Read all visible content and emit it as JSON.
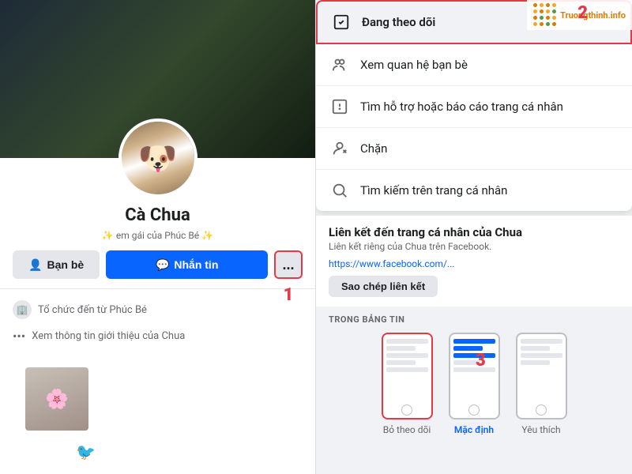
{
  "left": {
    "profile_name": "Cà Chua",
    "profile_subtitle": "✨ em gái của Phúc Bé ✨",
    "btn_friend": "Bạn bè",
    "btn_message": "Nhắn tin",
    "btn_more": "...",
    "detail_text": "Xem thông tin giới thiệu của Chua",
    "number_1": "1"
  },
  "right": {
    "menu_items": [
      {
        "icon": "☑",
        "label": "Đang theo dõi"
      },
      {
        "icon": "👥",
        "label": "Xem quan hệ bạn bè"
      },
      {
        "icon": "⚠",
        "label": "Tìm hỗ trợ hoặc báo cáo trang cá nhân"
      },
      {
        "icon": "🚫",
        "label": "Chặn"
      },
      {
        "icon": "🔍",
        "label": "Tìm kiếm trên trang cá nhân"
      }
    ],
    "link_title": "Liên kết đến trang cá nhân của Chua",
    "link_subtitle": "Liên kết riêng của Chua trên Facebook.",
    "link_url": "https://www.facebook.com/...",
    "copy_btn": "Sao chép liên kết",
    "feed_label": "TRONG BẢNG TIN",
    "feed_options": [
      {
        "label": "Bỏ theo dõi",
        "type": "unfollow"
      },
      {
        "label": "Mặc định",
        "type": "default",
        "active": true
      },
      {
        "label": "Yêu thích",
        "type": "favorite"
      }
    ],
    "number_2": "2",
    "number_3": "3",
    "watermark": "Truongthinh.info"
  }
}
